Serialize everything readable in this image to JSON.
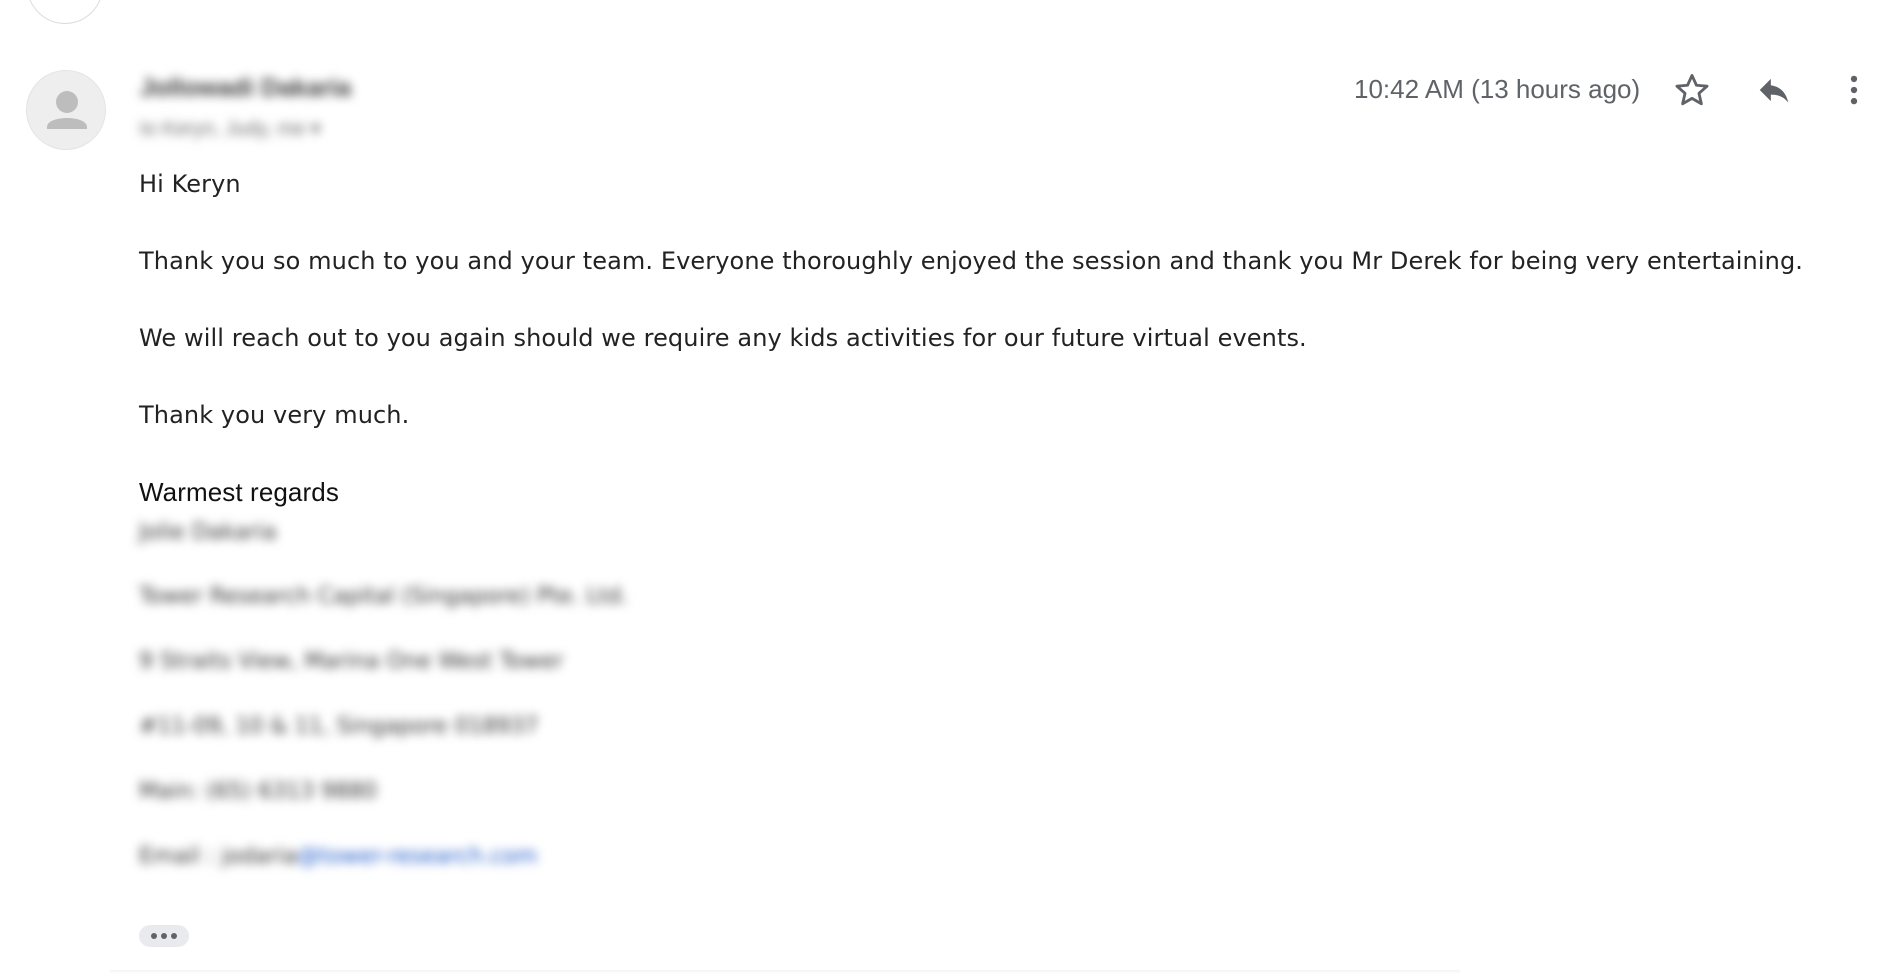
{
  "previous_message": {
    "avatar_icon": "avatar-circle"
  },
  "message": {
    "sender_name": "Jollowadi Dakaria",
    "recipient_line": "to Keryn, Judy, me ▾",
    "timestamp": "10:42 AM (13 hours ago)",
    "actions": {
      "star_icon": "star-outline-icon",
      "reply_icon": "reply-icon",
      "more_icon": "more-vert-icon"
    },
    "body": {
      "greeting": "Hi Keryn",
      "paragraph1": "Thank you so much to you and your team.  Everyone thoroughly enjoyed the session and thank you Mr Derek for being very entertaining.",
      "paragraph2": "We will reach out to you again should we require any kids activities for our future virtual events.",
      "paragraph3": "Thank you very much.",
      "closing": "Warmest regards"
    },
    "signature": {
      "name": "Jolie Dakaria",
      "company": "Tower Research Capital (Singapore) Pte. Ltd.",
      "address1": "9 Straits View, Marina One West Tower",
      "address2": "#11-09, 10 & 11, Singapore 018937",
      "main": "Main: (65) 6313 9880",
      "email_prefix": "Email : jodaria",
      "email_link": "@tower-research.com"
    },
    "trimmed_content_button": "show-trimmed-content"
  },
  "colors": {
    "text": "#222222",
    "muted": "#5f6368",
    "avatar_bg": "#eeeeee",
    "avatar_fg": "#bdbdbd",
    "link": "#1a56c8"
  }
}
